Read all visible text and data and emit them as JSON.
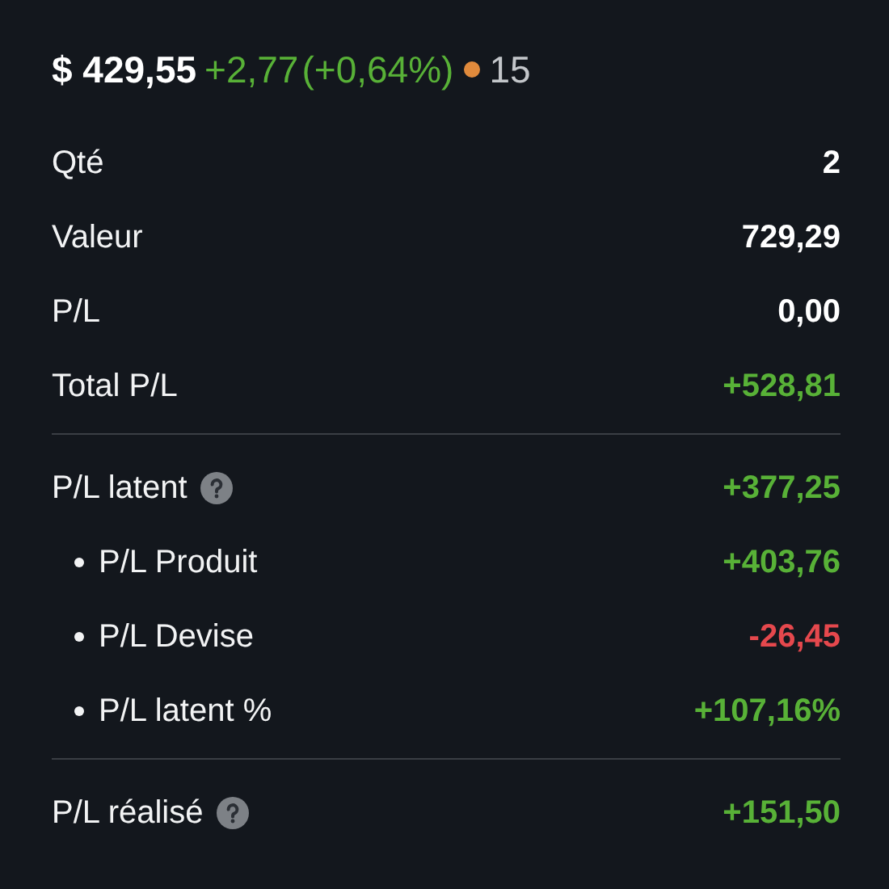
{
  "quote": {
    "price": "$ 429,55",
    "change": "+2,77",
    "change_pct": "(+0,64%)",
    "status_dot": {
      "color": "#e08a3c"
    },
    "count": "15"
  },
  "sections": [
    {
      "rows": [
        {
          "label": "Qté",
          "value": "2",
          "color": "#ffffff",
          "bullet": false,
          "help": false
        },
        {
          "label": "Valeur",
          "value": "729,29",
          "color": "#ffffff",
          "bullet": false,
          "help": false
        },
        {
          "label": "P/L",
          "value": "0,00",
          "color": "#ffffff",
          "bullet": false,
          "help": false
        },
        {
          "label": "Total P/L",
          "value": "+528,81",
          "color": "#58b137",
          "bullet": false,
          "help": false
        }
      ]
    },
    {
      "rows": [
        {
          "label": "P/L latent",
          "value": "+377,25",
          "color": "#58b137",
          "bullet": false,
          "help": true
        },
        {
          "label": "P/L Produit",
          "value": "+403,76",
          "color": "#58b137",
          "bullet": true,
          "help": false
        },
        {
          "label": "P/L Devise",
          "value": "-26,45",
          "color": "#e5484d",
          "bullet": true,
          "help": false
        },
        {
          "label": "P/L latent %",
          "value": "+107,16%",
          "color": "#58b137",
          "bullet": true,
          "help": false
        }
      ]
    },
    {
      "rows": [
        {
          "label": "P/L réalisé",
          "value": "+151,50",
          "color": "#58b137",
          "bullet": false,
          "help": true
        }
      ]
    }
  ]
}
